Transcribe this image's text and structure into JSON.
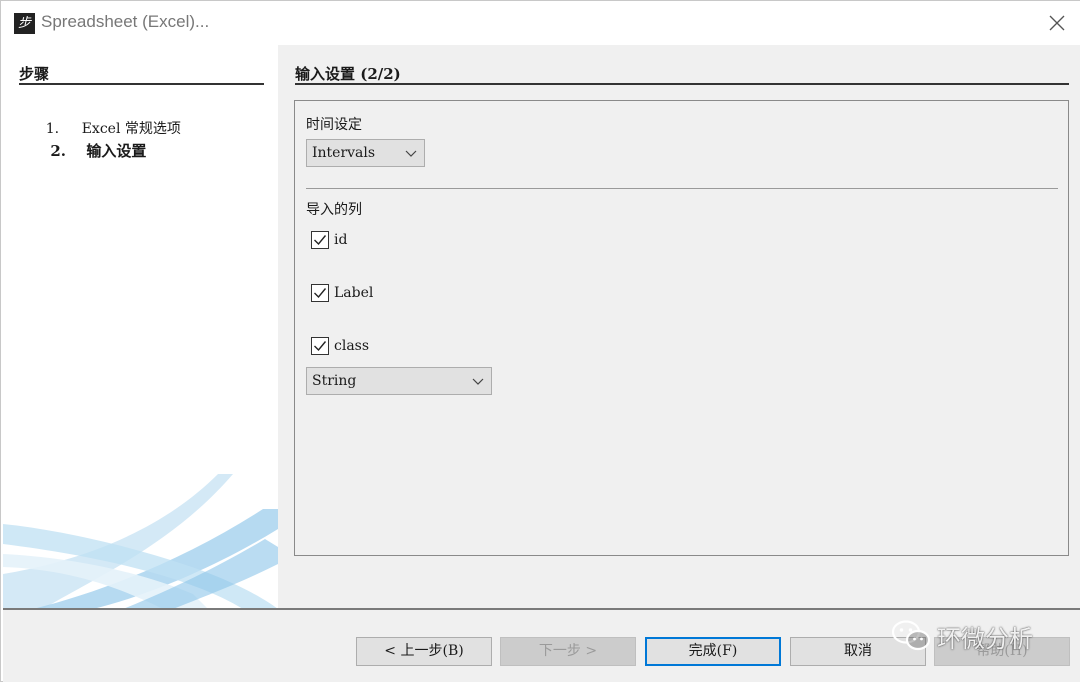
{
  "window": {
    "title": "Spreadsheet (Excel)...",
    "app_icon_glyph": "步"
  },
  "steps": {
    "heading": "步骤",
    "items": [
      {
        "number": "1.",
        "label": "Excel 常规选项",
        "current": false
      },
      {
        "number": "2.",
        "label": "输入设置",
        "current": true
      }
    ]
  },
  "main": {
    "heading": "输入设置 (2/2)",
    "time_setting": {
      "label": "时间设定",
      "selected": "Intervals"
    },
    "import_columns": {
      "label": "导入的列",
      "columns": [
        {
          "name": "id",
          "checked": true
        },
        {
          "name": "Label",
          "checked": true
        },
        {
          "name": "class",
          "checked": true
        }
      ],
      "type_selected": "String"
    }
  },
  "buttons": {
    "back": "< 上一步(B)",
    "next": "下一步 >",
    "finish": "完成(F)",
    "cancel": "取消",
    "help": "帮助(H)"
  },
  "watermark": {
    "text": "环微分析",
    "icon": "wechat-icon"
  },
  "colors": {
    "focus_border": "#0078d7",
    "panel_bg": "#f0f0f0"
  }
}
